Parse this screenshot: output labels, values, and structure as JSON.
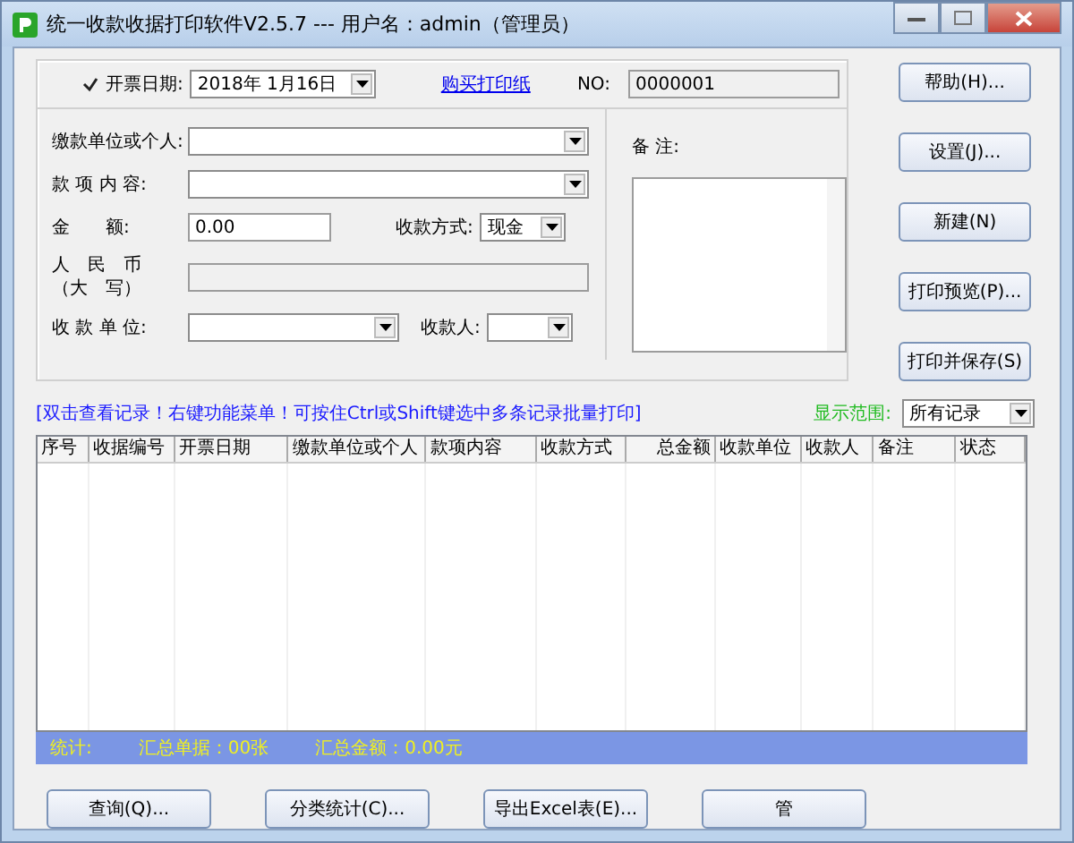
{
  "window": {
    "title": "统一收款收据打印软件V2.5.7 --- 用户名：admin（管理员）"
  },
  "form": {
    "date_enabled": {
      "label": "开票日期:",
      "checked": true
    },
    "date": "2018年  1月16日",
    "buy_link": "购买打印纸",
    "no_label": "NO:",
    "no_value": "0000001",
    "payer_label": "缴款单位或个人:",
    "item_label": "款 项 内 容:",
    "amount_label": "金　　额:",
    "amount_value": "0.00",
    "method_label": "收款方式:",
    "method_value": "现金",
    "rmb_label_1": "人　民　币",
    "rmb_label_2": "（大　写）",
    "unit_label": "收 款 单 位:",
    "receiver_label": "收款人:",
    "remark_label": "备 注:"
  },
  "side_buttons": [
    "帮助(H)...",
    "设置(J)...",
    "新建(N)",
    "打印预览(P)...",
    "打印并保存(S)"
  ],
  "hint": "[双击查看记录！右键功能菜单！可按住Ctrl或Shift键选中多条记录批量打印]",
  "range": {
    "label": "显示范围:",
    "value": "所有记录"
  },
  "table": {
    "columns": [
      "序号",
      "收据编号",
      "开票日期",
      "缴款单位或个人",
      "款项内容",
      "收款方式",
      "总金额",
      "收款单位",
      "收款人",
      "备注",
      "状态"
    ]
  },
  "status_bar": {
    "label": "统计:",
    "count": "汇总单据：00张",
    "total": "汇总金额：0.00元"
  },
  "bottom_buttons": [
    "查询(Q)...",
    "分类统计(C)...",
    "导出Excel表(E)...",
    "管"
  ]
}
